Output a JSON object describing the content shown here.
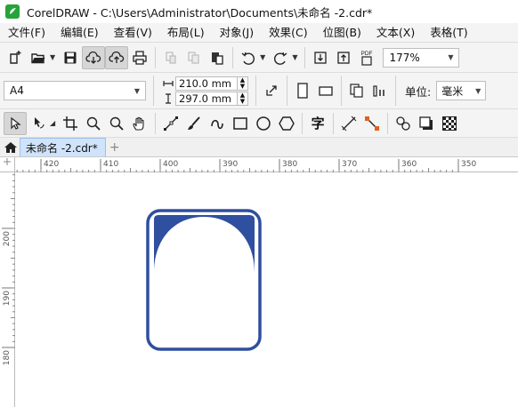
{
  "window": {
    "title": "CorelDRAW - C:\\Users\\Administrator\\Documents\\未命名 -2.cdr*"
  },
  "menu": [
    "文件(F)",
    "编辑(E)",
    "查看(V)",
    "布局(L)",
    "对象(J)",
    "效果(C)",
    "位图(B)",
    "文本(X)",
    "表格(T)"
  ],
  "toolbar": {
    "zoom": "177%",
    "pdf_label": "PDF"
  },
  "property_bar": {
    "page_size": "A4",
    "width": "210.0 mm",
    "height": "297.0 mm",
    "units_label": "单位:",
    "units_value": "毫米"
  },
  "toolbox": {
    "text_tool_glyph": "字"
  },
  "tabs": {
    "document": "未命名 -2.cdr*",
    "add": "+"
  },
  "ruler": {
    "h_labels": [
      "420",
      "410",
      "400",
      "390",
      "380",
      "370",
      "360",
      "350"
    ],
    "v_labels": [
      "200",
      "190",
      "180"
    ]
  },
  "colors": {
    "accent": "#2f4f9f",
    "app_logo": "#26a33a",
    "tab_active": "#cfe3fb"
  }
}
